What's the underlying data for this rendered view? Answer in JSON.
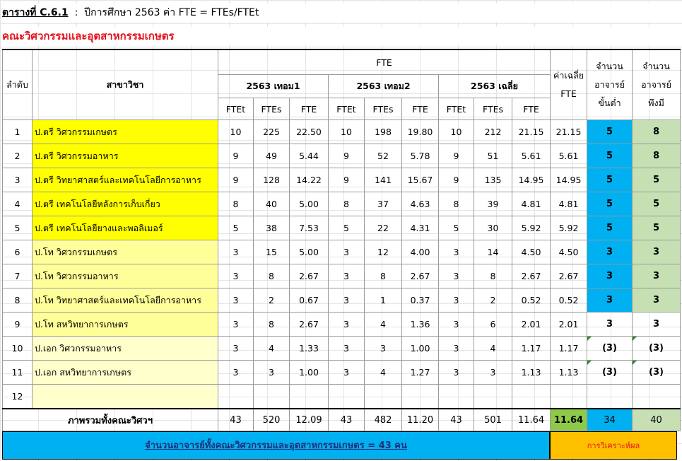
{
  "title": {
    "lead": "ตารางที่ C.6.1",
    "separator": "  :  ",
    "text": "ปีการศึกษา 2563 ค่า FTE = FTEs/FTEt"
  },
  "faculty_name": "คณะวิศวกรรมและอุตสาหกรรมเกษตร",
  "header": {
    "seq": "ลำดับ",
    "program": "สาขาวิชา",
    "fte": "FTE",
    "term1": "2563 เทอม1",
    "term2": "2563 เทอม2",
    "term_avg": "2563 เฉลี่ย",
    "sub": [
      "FTEt",
      "FTEs",
      "FTE"
    ],
    "avg_line1": "ค่าเฉลี่ย",
    "avg_line2": "FTE",
    "min_line1": "จำนวน",
    "min_line2": "อาจารย์",
    "min_line3": "ขั้นต่ำ",
    "req_line1": "จำนวน",
    "req_line2": "อาจารย์",
    "req_line3": "พึงมี"
  },
  "rows": [
    {
      "no": "1",
      "program": "ป.ตรี วิศวกรรมเกษตร",
      "t1": [
        "10",
        "225",
        "22.50"
      ],
      "t2": [
        "10",
        "198",
        "19.80"
      ],
      "ta": [
        "10",
        "212",
        "21.15"
      ],
      "avg": "21.15",
      "min": "5",
      "req": "8"
    },
    {
      "no": "2",
      "program": "ป.ตรี วิศวกรรมอาหาร",
      "t1": [
        "9",
        "49",
        "5.44"
      ],
      "t2": [
        "9",
        "52",
        "5.78"
      ],
      "ta": [
        "9",
        "51",
        "5.61"
      ],
      "avg": "5.61",
      "min": "5",
      "req": "8"
    },
    {
      "no": "3",
      "program": "ป.ตรี วิทยาศาสตร์และเทคโนโลยีการอาหาร",
      "t1": [
        "9",
        "128",
        "14.22"
      ],
      "t2": [
        "9",
        "141",
        "15.67"
      ],
      "ta": [
        "9",
        "135",
        "14.95"
      ],
      "avg": "14.95",
      "min": "5",
      "req": "5"
    },
    {
      "no": "4",
      "program": "ป.ตรี เทคโนโลยีหลังการเก็บเกี่ยว",
      "t1": [
        "8",
        "40",
        "5.00"
      ],
      "t2": [
        "8",
        "37",
        "4.63"
      ],
      "ta": [
        "8",
        "39",
        "4.81"
      ],
      "avg": "4.81",
      "min": "5",
      "req": "5"
    },
    {
      "no": "5",
      "program": "ป.ตรี เทคโนโลยียางและพอลิเมอร์",
      "t1": [
        "5",
        "38",
        "7.53"
      ],
      "t2": [
        "5",
        "22",
        "4.31"
      ],
      "ta": [
        "5",
        "30",
        "5.92"
      ],
      "avg": "5.92",
      "min": "5",
      "req": "5"
    },
    {
      "no": "6",
      "program": "ป.โท วิศวกรรมเกษตร",
      "t1": [
        "3",
        "15",
        "5.00"
      ],
      "t2": [
        "3",
        "12",
        "4.00"
      ],
      "ta": [
        "3",
        "14",
        "4.50"
      ],
      "avg": "4.50",
      "min": "3",
      "req": "3"
    },
    {
      "no": "7",
      "program": "ป.โท วิศวกรรมอาหาร",
      "t1": [
        "3",
        "8",
        "2.67"
      ],
      "t2": [
        "3",
        "8",
        "2.67"
      ],
      "ta": [
        "3",
        "8",
        "2.67"
      ],
      "avg": "2.67",
      "min": "3",
      "req": "3"
    },
    {
      "no": "8",
      "program": "ป.โท วิทยาศาสตร์และเทคโนโลยีการอาหาร",
      "t1": [
        "3",
        "2",
        "0.67"
      ],
      "t2": [
        "3",
        "1",
        "0.37"
      ],
      "ta": [
        "3",
        "2",
        "0.52"
      ],
      "avg": "0.52",
      "min": "3",
      "req": "3"
    },
    {
      "no": "9",
      "program": "ป.โท สหวิทยาการเกษตร",
      "t1": [
        "3",
        "8",
        "2.67"
      ],
      "t2": [
        "3",
        "4",
        "1.36"
      ],
      "ta": [
        "3",
        "6",
        "2.01"
      ],
      "avg": "2.01",
      "min": "3",
      "req": "3"
    },
    {
      "no": "10",
      "program": "ป.เอก วิศวกรรมอาหาร",
      "t1": [
        "3",
        "4",
        "1.33"
      ],
      "t2": [
        "3",
        "3",
        "1.00"
      ],
      "ta": [
        "3",
        "4",
        "1.17"
      ],
      "avg": "1.17",
      "min": "(3)",
      "req": "(3)"
    },
    {
      "no": "11",
      "program": "ป.เอก สหวิทยาการเกษตร",
      "t1": [
        "3",
        "3",
        "1.00"
      ],
      "t2": [
        "3",
        "4",
        "1.27"
      ],
      "ta": [
        "3",
        "3",
        "1.13"
      ],
      "avg": "1.13",
      "min": "(3)",
      "req": "(3)"
    },
    {
      "no": "12",
      "program": "",
      "t1": [
        "",
        "",
        ""
      ],
      "t2": [
        "",
        "",
        ""
      ],
      "ta": [
        "",
        "",
        ""
      ],
      "avg": "",
      "min": "",
      "req": ""
    }
  ],
  "total": {
    "label": "ภาพรวมทั้งคณะวิศวฯ",
    "t1": [
      "43",
      "520",
      "12.09"
    ],
    "t2": [
      "43",
      "482",
      "11.20"
    ],
    "ta": [
      "43",
      "501",
      "11.64"
    ],
    "avg": "11.64",
    "min": "34",
    "req": "40"
  },
  "footer": {
    "staff_count": "จำนวนอาจารย์ทั้งคณะวิศวกรรมและอุตสาหกรรมเกษตร = 43 คน",
    "analysis": "การวิเคราะห์ผล"
  },
  "colors": {
    "faculty_text": "#e8101a",
    "bachelor_fill": "#ffff00",
    "master_fill": "#ffff99",
    "doctor_fill": "#ffffcc",
    "min_fill": "#00b0f0",
    "req_fill": "#c6e0b4",
    "total_avg_fill": "#8fc94a",
    "analysis_fill": "#ffc000"
  }
}
